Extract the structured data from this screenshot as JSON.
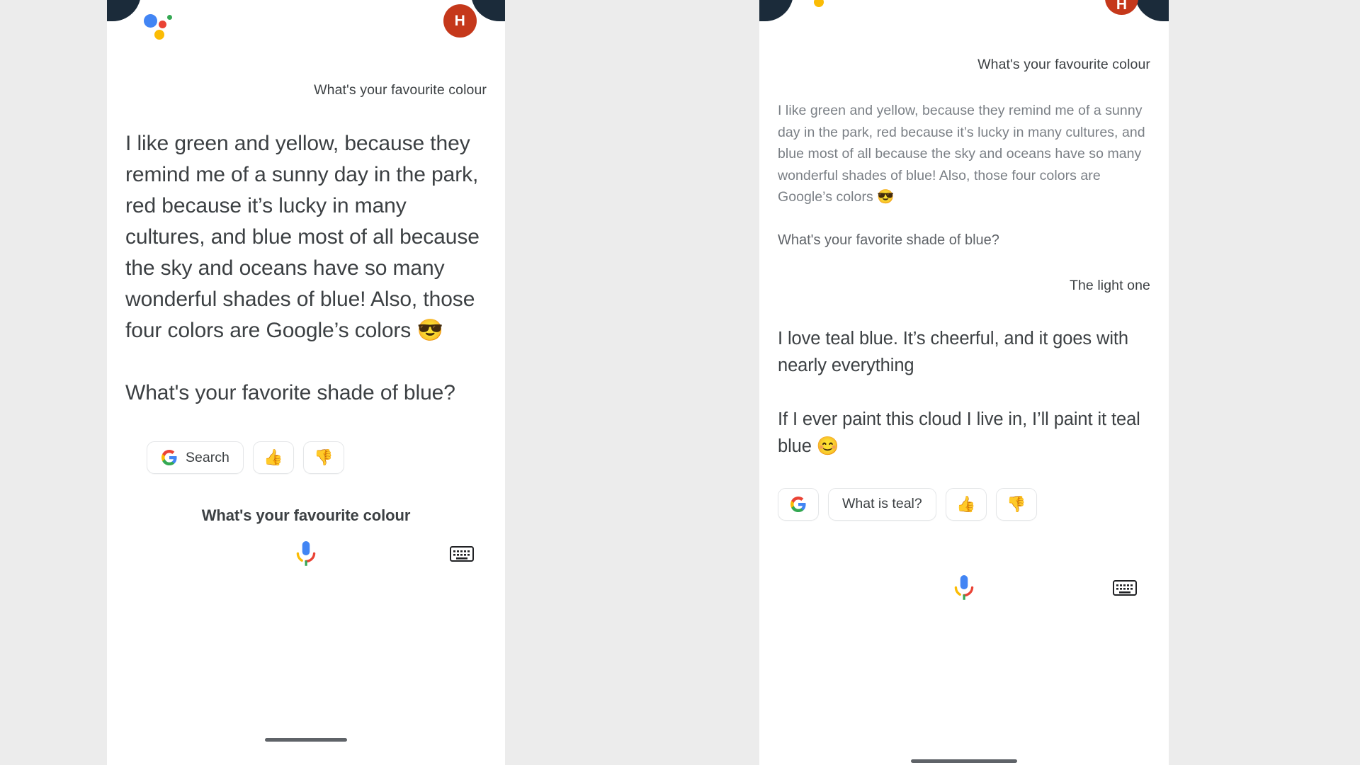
{
  "app": {
    "name": "Google Assistant",
    "background_color": "#ececec",
    "surface_color": "#ffffff",
    "avatar_color": "#C5381B",
    "assistant_dot_colors": {
      "blue": "#4285F4",
      "red": "#EA4335",
      "yellow": "#FBBC05",
      "green": "#34A853"
    }
  },
  "left_screen": {
    "avatar_initial": "H",
    "assistant_logo": "assistant-dots-icon",
    "user_query": "What's your favourite colour",
    "assistant_reply": "I like green and yellow, because they remind me of a sunny day in the park, red because it’s lucky in many cultures, and blue most of all because the sky and oceans have so many wonderful shades of blue! Also, those four colors are Google’s colors 😎",
    "assistant_followup": "What's your favorite shade of blue?",
    "chips": [
      {
        "icon": "google-g-icon",
        "label": "Search"
      },
      {
        "icon": "thumbs-up-icon",
        "label": "👍"
      },
      {
        "icon": "thumbs-down-icon",
        "label": "👎"
      }
    ],
    "transcript": "What's your favourite colour",
    "mic_label": "mic-icon",
    "keyboard_label": "keyboard-icon"
  },
  "right_screen": {
    "avatar_initial": "H",
    "assistant_logo": "assistant-dots-icon",
    "user_query": "What's your favourite colour",
    "assistant_reply_faded": "I like green and yellow, because they remind me of a sunny day in the park, red because it’s lucky in many cultures, and blue most of all because the sky and oceans have so many wonderful shades of blue! Also, those four colors are Google’s colors 😎",
    "assistant_followup": "What's your favorite shade of blue?",
    "user_reply": "The light one",
    "assistant_answer_1": "I love teal blue. It’s cheerful, and it goes with nearly everything",
    "assistant_answer_2": "If I ever paint this cloud I live in, I’ll paint it teal blue 😊",
    "chips": [
      {
        "icon": "google-g-icon",
        "label": ""
      },
      {
        "icon": "",
        "label": "What is teal?"
      },
      {
        "icon": "thumbs-up-icon",
        "label": "👍"
      },
      {
        "icon": "thumbs-down-icon",
        "label": "👎"
      }
    ],
    "mic_label": "mic-icon",
    "keyboard_label": "keyboard-icon"
  }
}
